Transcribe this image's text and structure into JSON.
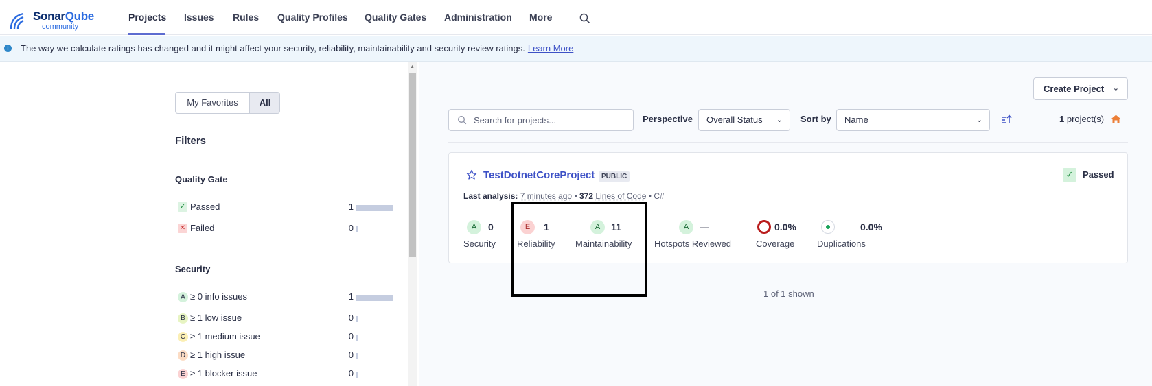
{
  "app": {
    "brand_main": "Sonar",
    "brand_accent": "Qube",
    "brand_sub": "community"
  },
  "nav": {
    "items": [
      "Projects",
      "Issues",
      "Rules",
      "Quality Profiles",
      "Quality Gates",
      "Administration",
      "More"
    ],
    "active": "Projects"
  },
  "banner": {
    "text": "The way we calculate ratings has changed and it might affect your security, reliability, maintainability and security review ratings.",
    "link": "Learn More"
  },
  "sidebar": {
    "toggle": {
      "favorites": "My Favorites",
      "all": "All"
    },
    "filters_title": "Filters",
    "quality_gate": {
      "title": "Quality Gate",
      "rows": [
        {
          "label": "Passed",
          "count": "1",
          "fill": 1.0
        },
        {
          "label": "Failed",
          "count": "0",
          "fill": 0
        }
      ]
    },
    "security": {
      "title": "Security",
      "rows": [
        {
          "rating": "A",
          "label": "≥ 0 info issues",
          "count": "1",
          "fill": 1.0
        },
        {
          "rating": "B",
          "label": "≥ 1 low issue",
          "count": "0",
          "fill": 0
        },
        {
          "rating": "C",
          "label": "≥ 1 medium issue",
          "count": "0",
          "fill": 0
        },
        {
          "rating": "D",
          "label": "≥ 1 high issue",
          "count": "0",
          "fill": 0
        },
        {
          "rating": "E",
          "label": "≥ 1 blocker issue",
          "count": "0",
          "fill": 0
        }
      ]
    }
  },
  "toolbar": {
    "create_project": "Create Project",
    "search_placeholder": "Search for projects...",
    "perspective_label": "Perspective",
    "perspective_value": "Overall Status",
    "sort_label": "Sort by",
    "sort_value": "Name",
    "project_count": "1",
    "project_count_suffix": " project(s)"
  },
  "project": {
    "name": "TestDotnetCoreProject",
    "visibility": "PUBLIC",
    "status": "Passed",
    "last_analysis_label": "Last analysis:",
    "last_analysis_value": "7 minutes ago",
    "loc_value": "372",
    "loc_label": "Lines of Code",
    "language": "C#",
    "metrics": {
      "security": {
        "rating": "A",
        "value": "0",
        "label": "Security"
      },
      "reliability": {
        "rating": "E",
        "value": "1",
        "label": "Reliability"
      },
      "maintainability": {
        "rating": "A",
        "value": "11",
        "label": "Maintainability"
      },
      "hotspots": {
        "rating": "A",
        "value": "—",
        "label": "Hotspots Reviewed"
      },
      "coverage": {
        "value": "0.0%",
        "label": "Coverage"
      },
      "duplications": {
        "value": "0.0%",
        "label": "Duplications"
      }
    }
  },
  "footer_shown": "1 of 1 shown",
  "colors": {
    "accent": "#5d6cd0",
    "link": "#3d51c6",
    "passed": "#1b8a3b",
    "failed": "#c52a2a"
  }
}
